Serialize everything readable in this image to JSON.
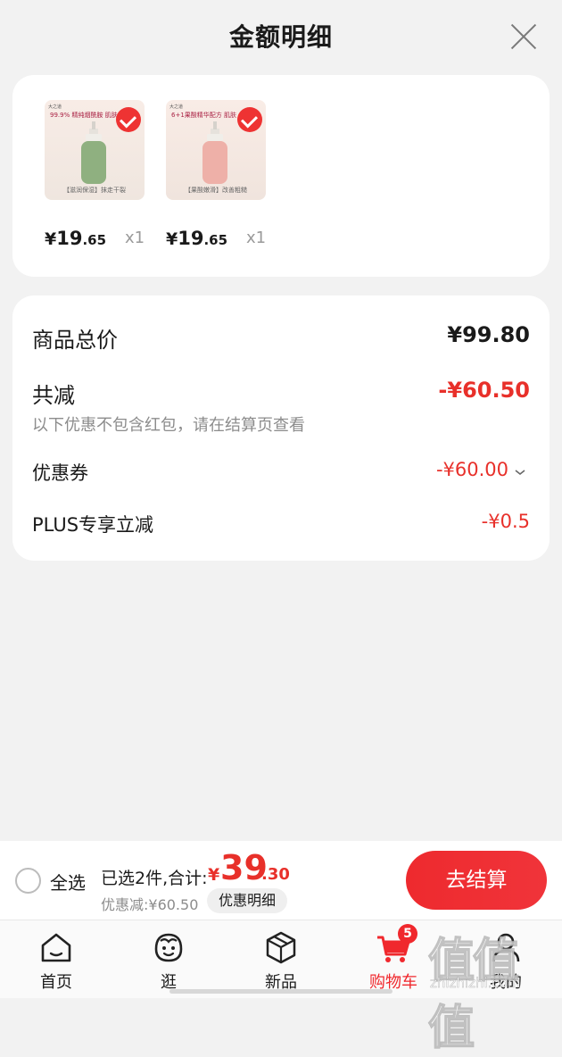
{
  "header": {
    "title": "金额明细"
  },
  "products": [
    {
      "top_text": "99.9% 精纯烟酰胺 肌肤",
      "brand": "大之道",
      "bottom_text": "【滋润保湿】抹走干裂",
      "yen": "¥",
      "price_int": "19",
      "price_dec": ".65",
      "qty": "x1"
    },
    {
      "top_text": "6+1果酸精华配方 肌肤",
      "brand": "大之道",
      "bottom_text": "【果酸嫩滑】改善粗糙",
      "yen": "¥",
      "price_int": "19",
      "price_dec": ".65",
      "qty": "x1"
    }
  ],
  "summary": {
    "total_label": "商品总价",
    "total_value": "¥99.80",
    "reduce_label": "共减",
    "reduce_value": "-¥60.50",
    "reduce_note": "以下优惠不包含红包，请在结算页查看",
    "coupon_label": "优惠券",
    "coupon_value": "-¥60.00",
    "plus_label": "PLUS专享立减",
    "plus_value": "-¥0.5"
  },
  "bottom": {
    "select_all": "全选",
    "selected_text": "已选2件,合计:",
    "yen": "¥",
    "total_int": "39",
    "total_dec": ".30",
    "discount_text": "优惠减:¥60.50",
    "detail_button": "优惠明细",
    "checkout_button": "去结算"
  },
  "tabs": [
    {
      "label": "首页",
      "icon": "home-icon"
    },
    {
      "label": "逛",
      "icon": "stroll-icon"
    },
    {
      "label": "新品",
      "icon": "new-product-icon"
    },
    {
      "label": "购物车",
      "icon": "cart-icon",
      "badge": "5"
    },
    {
      "label": "我的",
      "icon": "profile-icon"
    }
  ],
  "watermark": {
    "glyphs": "值值值",
    "url": "zhizhizhi.com"
  },
  "colors": {
    "accent_red": "#e8302a",
    "checkout_red": "#ee2a2e",
    "text_dark": "#1a1a1a",
    "text_gray": "#8c8c8c",
    "bg": "#f2f2f2"
  }
}
